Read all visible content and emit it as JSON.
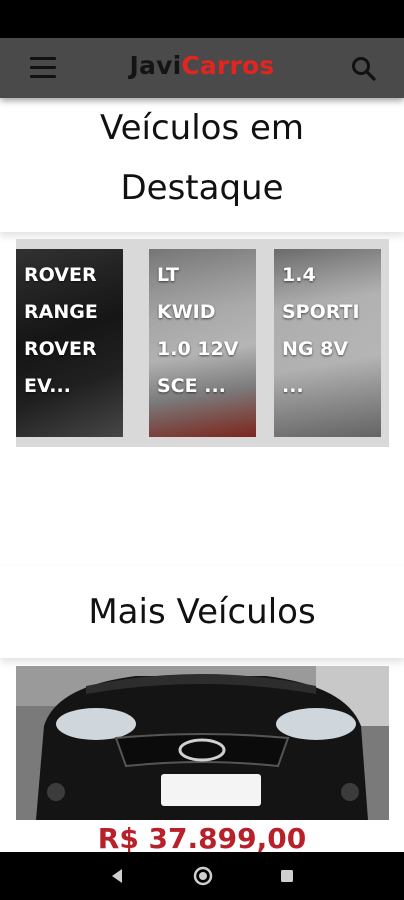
{
  "app": {
    "brand_part1": "Javi",
    "brand_part2": "Carros",
    "brand_color": "#e3241f"
  },
  "header": {
    "menu_icon": "hamburger-menu-icon",
    "search_icon": "search-icon"
  },
  "featured": {
    "title_line1": "Veículos em",
    "title_line2": "Destaque",
    "cards": [
      {
        "label": "ROVER\nRANGE\nROVER\nEV..."
      },
      {
        "label": "LT\nKWID\n1.0 12V\nSCE ..."
      },
      {
        "label": "1.4\nSPORTI\nNG 8V\n..."
      }
    ]
  },
  "more": {
    "title": "Mais Veículos",
    "price": "R$ 37.899,00"
  },
  "system_nav": {
    "back_icon": "back-triangle-icon",
    "home_icon": "home-circle-icon",
    "recents_icon": "recents-square-icon"
  }
}
